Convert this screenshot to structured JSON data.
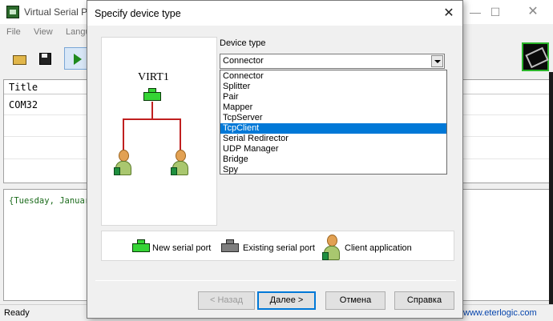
{
  "main_window": {
    "title": "Virtual Serial Ports",
    "menu": [
      "File",
      "View",
      "Language"
    ],
    "list": {
      "column_title": "Title",
      "rows": [
        "COM32"
      ]
    },
    "log_line": "{Tuesday, January",
    "status": "Ready",
    "status_link": "www.eterlogic.com"
  },
  "dialog": {
    "title": "Specify device type",
    "close_glyph": "✕",
    "preview": {
      "port_name": "VIRT1"
    },
    "device_type_label": "Device type",
    "device_type_selected": "Connector",
    "options": [
      "Connector",
      "Splitter",
      "Pair",
      "Mapper",
      "TcpServer",
      "TcpClient",
      "Serial Redirector",
      "UDP Manager",
      "Bridge",
      "Spy"
    ],
    "highlighted_option_index": 5,
    "legend": {
      "new_serial_port": "New serial port",
      "existing_serial_port": "Existing serial port",
      "client_application": "Client application"
    },
    "buttons": {
      "back": "< Назад",
      "next": "Далее >",
      "cancel": "Отмена",
      "help": "Справка"
    }
  },
  "colors": {
    "selection": "#0078d7",
    "tree_line": "#c02020",
    "new_port": "#35d435",
    "existing_port": "#7e7e7e"
  },
  "icons": {
    "main_window": [
      "app-icon",
      "open-folder-icon",
      "save-disk-icon",
      "run-play-icon",
      "network-device-icon"
    ],
    "dialog": [
      "serial-port-new-icon",
      "serial-port-existing-icon",
      "client-person-icon",
      "chevron-down-icon",
      "close-icon"
    ]
  }
}
